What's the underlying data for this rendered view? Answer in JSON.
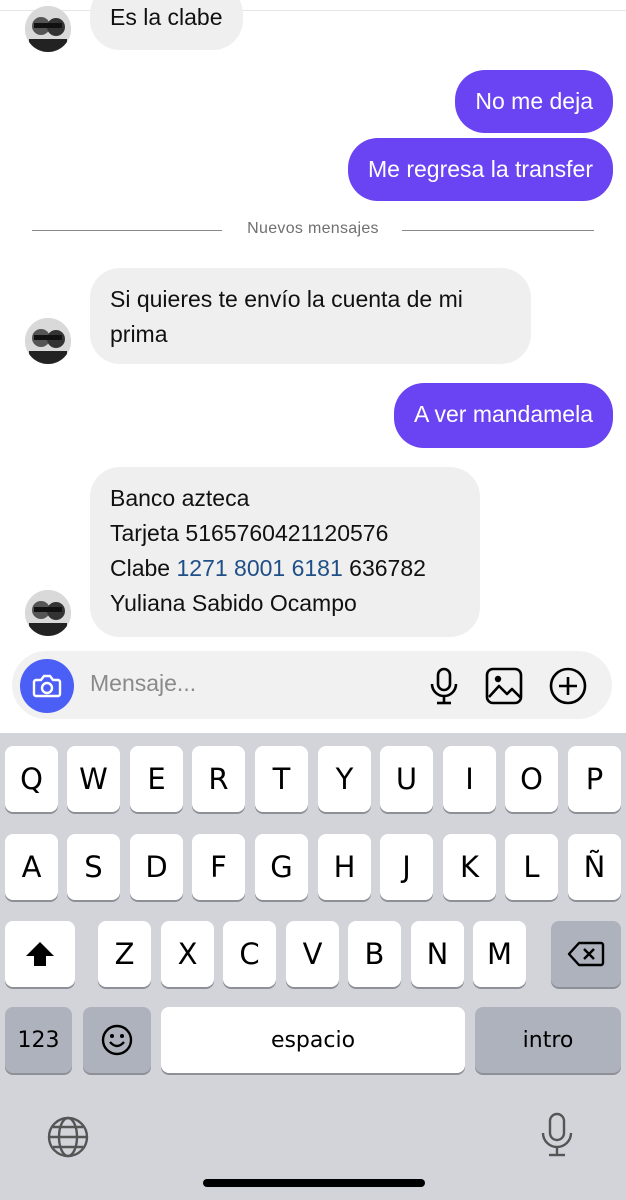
{
  "messages": {
    "m1": "Es la clabe",
    "m2": "No me deja",
    "m3": "Me regresa la transfer",
    "divider": "Nuevos mensajes",
    "m4_line1": "Si quieres te envío la cuenta de mi",
    "m4_line2": "prima",
    "m5": "A ver mandamela",
    "m6_line1": "Banco azteca",
    "m6_line2": "Tarjeta 5165760421120576",
    "m6_line3_prefix": "Clabe ",
    "m6_line3_link": "1271 8001 6181",
    "m6_line3_suffix": " 636782",
    "m6_line4": "Yuliana Sabido Ocampo"
  },
  "composer": {
    "placeholder": "Mensaje...",
    "icons": [
      "camera-icon",
      "microphone-icon",
      "image-icon",
      "add-circle-icon"
    ]
  },
  "keyboard": {
    "row1": [
      "Q",
      "W",
      "E",
      "R",
      "T",
      "Y",
      "U",
      "I",
      "O",
      "P"
    ],
    "row2": [
      "A",
      "S",
      "D",
      "F",
      "G",
      "H",
      "J",
      "K",
      "L",
      "Ñ"
    ],
    "row3": [
      "Z",
      "X",
      "C",
      "V",
      "B",
      "N",
      "M"
    ],
    "numbers": "123",
    "space": "espacio",
    "return": "intro"
  },
  "colors": {
    "outgoing_bubble": "#6a43f2",
    "incoming_bubble": "#efefef",
    "camera_button": "#4b5ef5",
    "link": "#1f4f86",
    "keyboard_bg": "#d2d4da"
  }
}
